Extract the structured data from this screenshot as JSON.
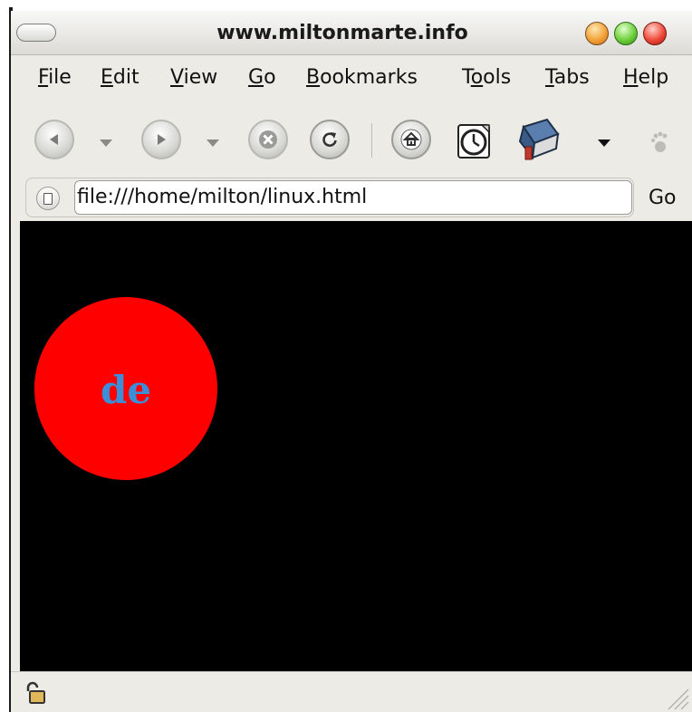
{
  "window": {
    "title": "www.miltonmarte.info"
  },
  "menu": {
    "items": [
      {
        "pre": "",
        "u": "F",
        "post": "ile"
      },
      {
        "pre": "",
        "u": "E",
        "post": "dit"
      },
      {
        "pre": "",
        "u": "V",
        "post": "iew"
      },
      {
        "pre": "",
        "u": "G",
        "post": "o"
      },
      {
        "pre": "",
        "u": "B",
        "post": "ookmarks"
      },
      {
        "pre": "T",
        "u": "o",
        "post": "ols"
      },
      {
        "pre": "",
        "u": "T",
        "post": "abs"
      },
      {
        "pre": "",
        "u": "H",
        "post": "elp"
      }
    ]
  },
  "toolbar": {
    "icons": [
      "back-icon",
      "forward-icon",
      "stop-icon",
      "reload-icon",
      "home-icon",
      "history-icon",
      "bookmarks-icon",
      "throbber-icon"
    ]
  },
  "location": {
    "url": "file:///home/milton/linux.html",
    "go_label": "Go"
  },
  "content": {
    "background": "#000000",
    "circle_color": "#ff0000",
    "circle_text": "de",
    "circle_text_color": "#3b8ed8"
  }
}
